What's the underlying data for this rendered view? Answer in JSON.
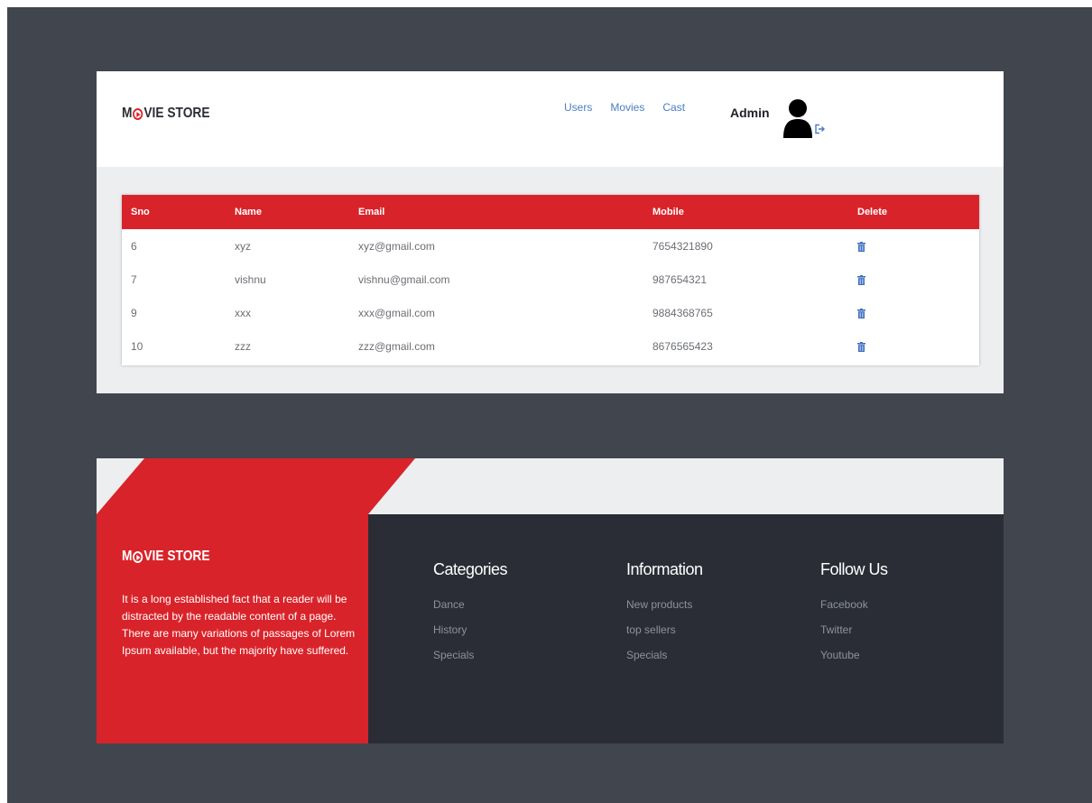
{
  "brand": {
    "prefix": "M",
    "suffix": "VIE STORE"
  },
  "nav": {
    "links": [
      "Users",
      "Movies",
      "Cast"
    ],
    "admin_label": "Admin"
  },
  "table": {
    "headers": [
      "Sno",
      "Name",
      "Email",
      "Mobile",
      "Delete"
    ],
    "rows": [
      {
        "sno": "6",
        "name": "xyz",
        "email": "xyz@gmail.com",
        "mobile": "7654321890"
      },
      {
        "sno": "7",
        "name": "vishnu",
        "email": "vishnu@gmail.com",
        "mobile": "987654321"
      },
      {
        "sno": "9",
        "name": "xxx",
        "email": "xxx@gmail.com",
        "mobile": "9884368765"
      },
      {
        "sno": "10",
        "name": "zzz",
        "email": "zzz@gmail.com",
        "mobile": "8676565423"
      }
    ]
  },
  "footer": {
    "about_line1": "It is a long established fact that a reader will be distracted by the readable content of a page.",
    "about_line2": "There are many variations of passages of Lorem Ipsum available, but the majority have suffered.",
    "columns": [
      {
        "title": "Categories",
        "items": [
          "Dance",
          "History",
          "Specials"
        ]
      },
      {
        "title": "Information",
        "items": [
          "New products",
          "top sellers",
          "Specials"
        ]
      },
      {
        "title": "Follow Us",
        "items": [
          "Facebook",
          "Twitter",
          "Youtube"
        ]
      }
    ]
  },
  "icons": {
    "avatar": "user-silhouette-icon",
    "logout": "logout-icon",
    "delete": "trash-icon",
    "brand_o": "play-circle-icon"
  },
  "colors": {
    "accent_red": "#d9232a",
    "background_dark": "#41454e",
    "footer_dark": "#2a2d36",
    "link_blue": "#4a7ec2"
  }
}
